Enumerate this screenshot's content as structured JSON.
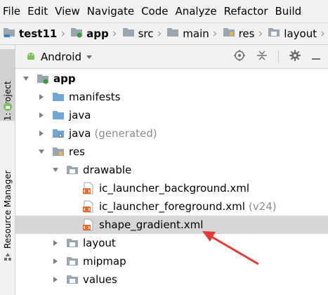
{
  "menu": [
    "File",
    "Edit",
    "View",
    "Navigate",
    "Code",
    "Analyze",
    "Refactor",
    "Build"
  ],
  "breadcrumbs": [
    "test11",
    "app",
    "src",
    "main",
    "res",
    "layout"
  ],
  "left_toolwindows": {
    "project": "1: Project",
    "resource_manager": "Resource Manager"
  },
  "panel": {
    "view_label": "Android"
  },
  "tree": {
    "app": "app",
    "manifests": "manifests",
    "java": "java",
    "java_generated": "java",
    "java_generated_suffix": "(generated)",
    "res": "res",
    "drawable": "drawable",
    "file1": "ic_launcher_background.xml",
    "file2": "ic_launcher_foreground.xml",
    "file2_suffix": "(v24)",
    "file3": "shape_gradient.xml",
    "layout": "layout",
    "mipmap": "mipmap",
    "values": "values"
  },
  "colors": {
    "folder_blue": "#6fa7d6",
    "folder_gray": "#9aa7b0",
    "android_green": "#78c257",
    "xml_orange": "#e8692c",
    "selection": "#d6d6d6",
    "annotation_arrow": "#e53935"
  },
  "icons": [
    "folder-icon",
    "module-icon",
    "android-icon",
    "xml-file-icon",
    "locate-icon",
    "collapse-all-icon",
    "settings-gear-icon",
    "hide-icon"
  ]
}
